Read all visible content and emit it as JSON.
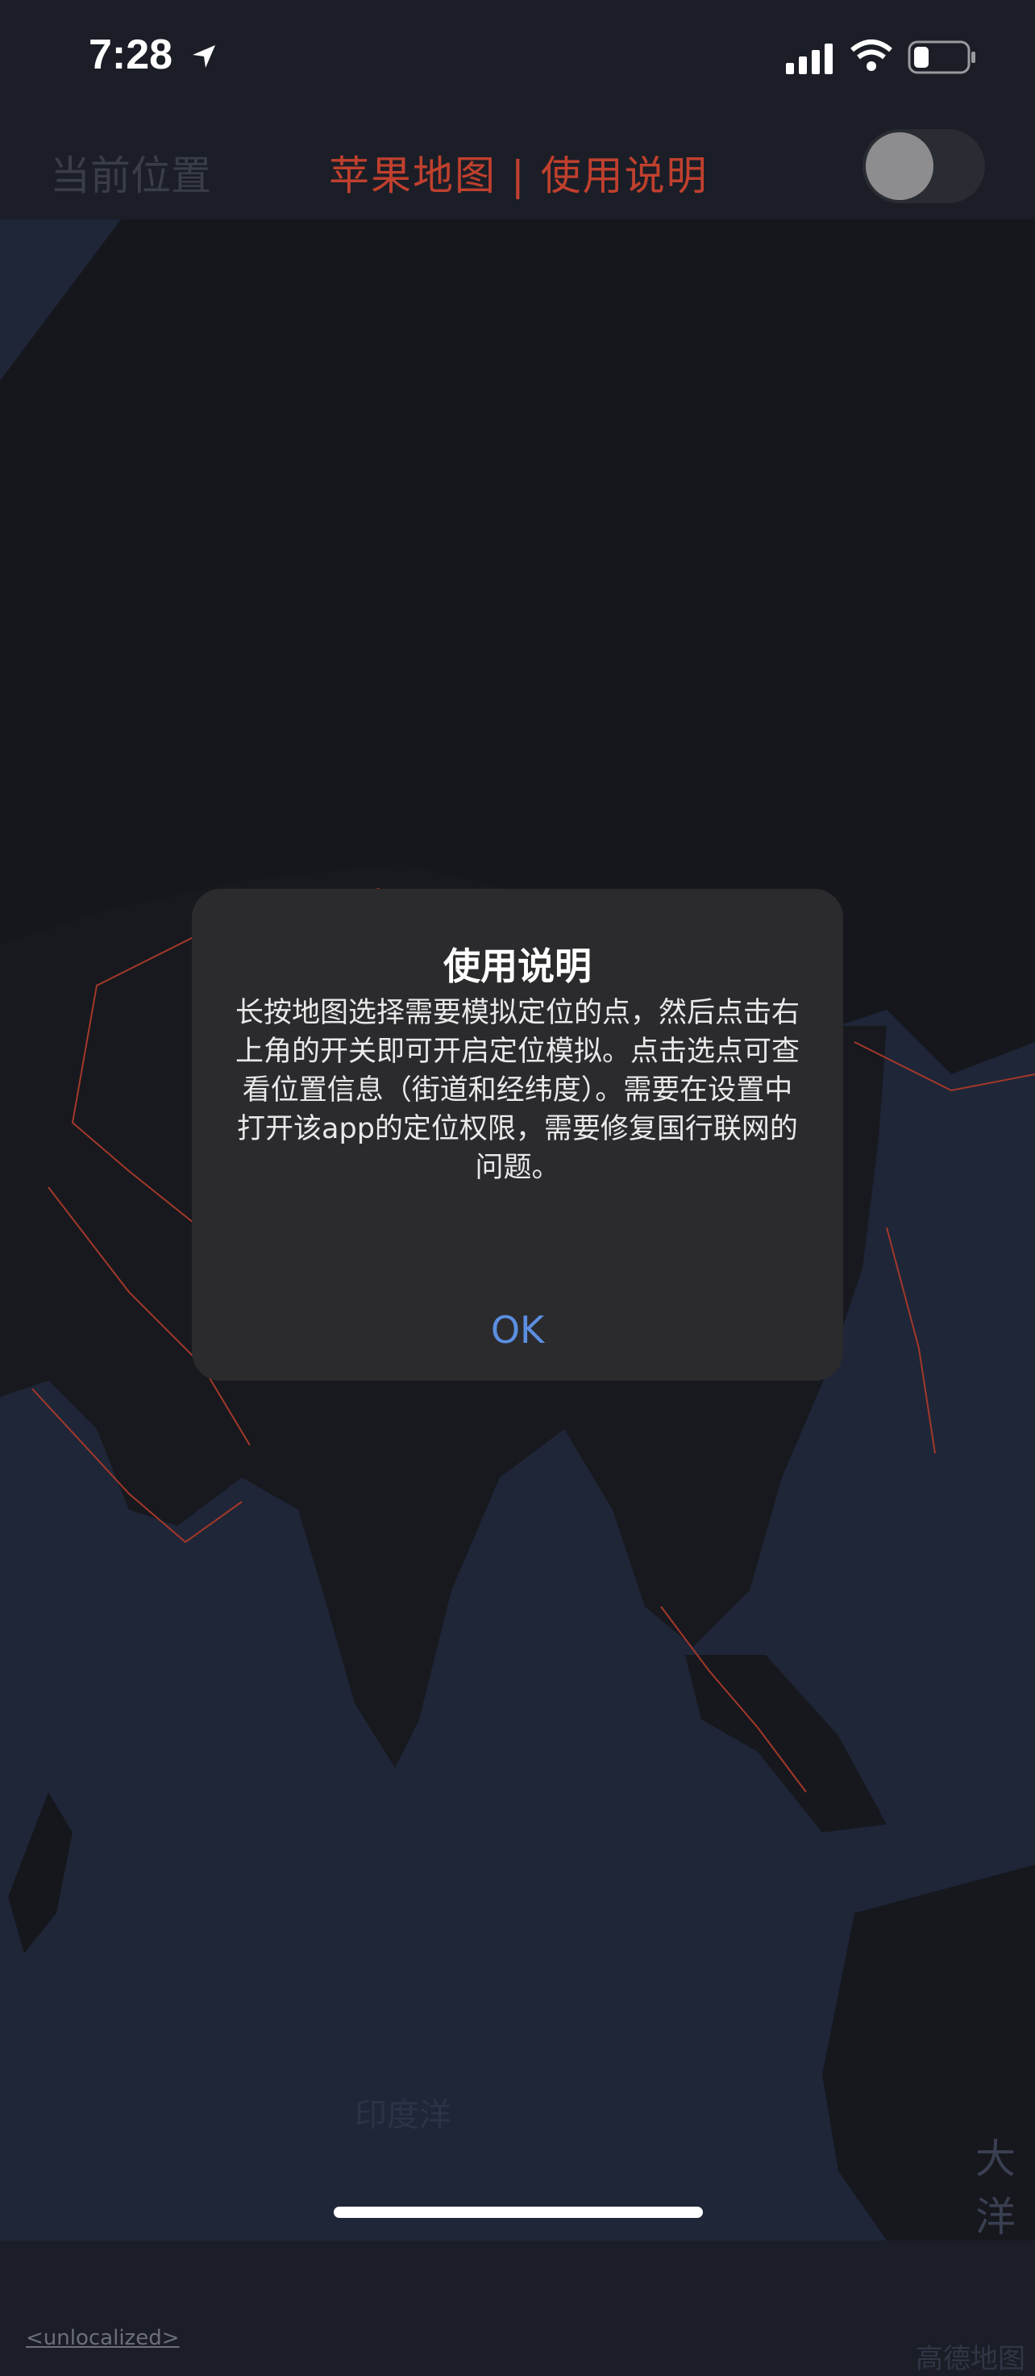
{
  "status_bar": {
    "time": "7:28"
  },
  "nav": {
    "left_label": "当前位置",
    "title": "苹果地图 | 使用说明",
    "toggle_on": false
  },
  "map": {
    "ocean_label": "印度洋",
    "ocean_label_partial": "大洋",
    "logo_text": "高德地图",
    "unlocalized_link": "<unlocalized>"
  },
  "dialog": {
    "title": "使用说明",
    "message": "长按地图选择需要模拟定位的点，然后点击右上角的开关即可开启定位模拟。点击选点可查看位置信息（街道和经纬度）。需要在设置中打开该app的定位权限，需要修复国行联网的问题。",
    "ok_label": "OK"
  },
  "colors": {
    "accent": "#c0402e",
    "ok_blue": "#5b8fe0",
    "map_ocean": "#1f2638",
    "map_land": "#16181d",
    "border_red": "#a4382a"
  }
}
